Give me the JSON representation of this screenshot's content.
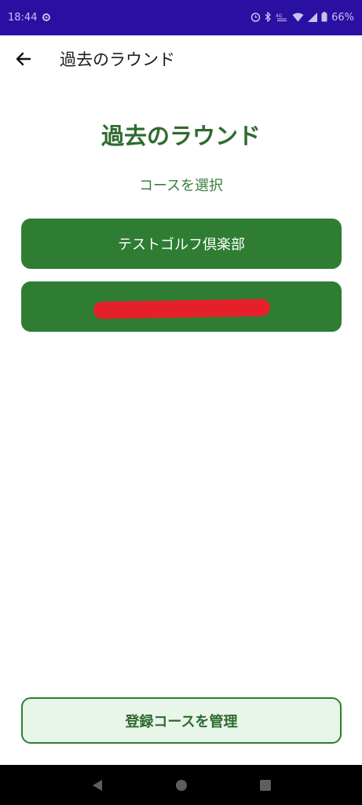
{
  "status_bar": {
    "time": "18:44",
    "battery": "66%",
    "icons": [
      "settings-gear-icon",
      "alarm-icon",
      "bluetooth-icon",
      "data-signal-icon",
      "wifi-icon",
      "cell-signal-icon",
      "battery-icon"
    ]
  },
  "app_bar": {
    "back_icon": "arrow-back-icon",
    "title": "過去のラウンド"
  },
  "main": {
    "heading": "過去のラウンド",
    "subtitle": "コースを選択",
    "courses": [
      {
        "label": "テストゴルフ倶楽部"
      },
      {
        "label": "",
        "redacted": true
      }
    ],
    "manage_button": "登録コースを管理"
  },
  "nav_bar": {
    "icons": [
      "nav-back-icon",
      "nav-home-icon",
      "nav-recents-icon"
    ]
  },
  "colors": {
    "status_bar": "#2a0fa3",
    "primary_green": "#2e7d32",
    "heading_green": "#2e6b2f",
    "manage_bg": "#e8f5e9",
    "redaction": "#e5202a"
  }
}
